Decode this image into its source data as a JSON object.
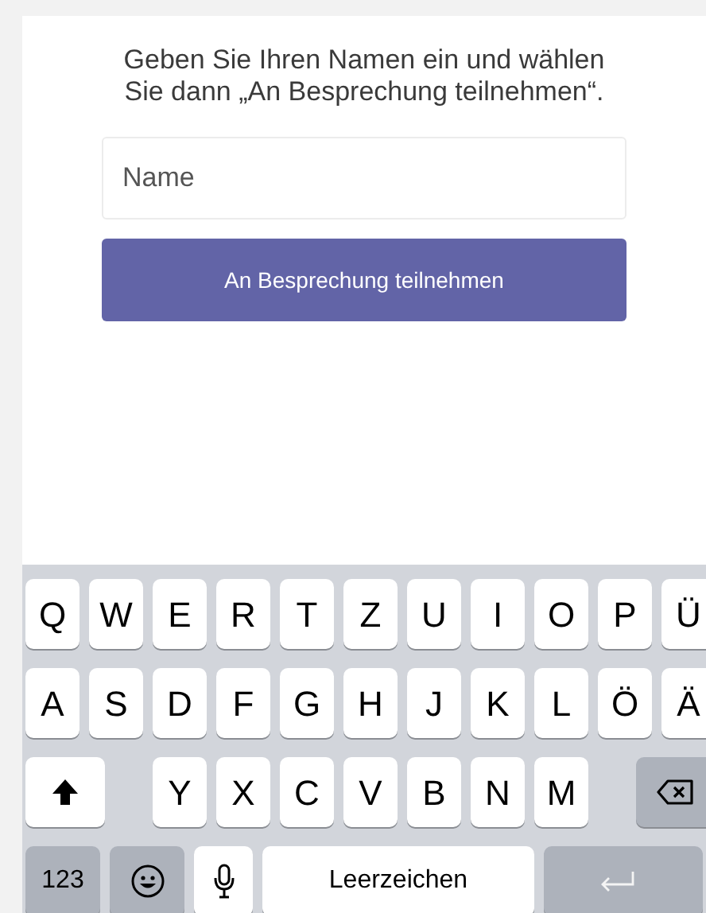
{
  "prompt": "Geben Sie Ihren Namen ein und wählen Sie dann „An Besprechung teilnehmen“.",
  "name_field": {
    "placeholder": "Name"
  },
  "join_button": {
    "label": "An Besprechung teilnehmen"
  },
  "keyboard": {
    "rows": [
      {
        "keys": [
          {
            "kind": "letter",
            "label": "Q"
          },
          {
            "kind": "letter",
            "label": "W"
          },
          {
            "kind": "letter",
            "label": "E"
          },
          {
            "kind": "letter",
            "label": "R"
          },
          {
            "kind": "letter",
            "label": "T"
          },
          {
            "kind": "letter",
            "label": "Z"
          },
          {
            "kind": "letter",
            "label": "U"
          },
          {
            "kind": "letter",
            "label": "I"
          },
          {
            "kind": "letter",
            "label": "O"
          },
          {
            "kind": "letter",
            "label": "P"
          },
          {
            "kind": "letter",
            "label": "Ü"
          }
        ]
      },
      {
        "keys": [
          {
            "kind": "letter",
            "label": "A"
          },
          {
            "kind": "letter",
            "label": "S"
          },
          {
            "kind": "letter",
            "label": "D"
          },
          {
            "kind": "letter",
            "label": "F"
          },
          {
            "kind": "letter",
            "label": "G"
          },
          {
            "kind": "letter",
            "label": "H"
          },
          {
            "kind": "letter",
            "label": "J"
          },
          {
            "kind": "letter",
            "label": "K"
          },
          {
            "kind": "letter",
            "label": "L"
          },
          {
            "kind": "letter",
            "label": "Ö"
          },
          {
            "kind": "letter",
            "label": "Ä"
          }
        ]
      },
      {
        "keys": [
          {
            "kind": "shift"
          },
          {
            "kind": "letter",
            "label": "Y"
          },
          {
            "kind": "letter",
            "label": "X"
          },
          {
            "kind": "letter",
            "label": "C"
          },
          {
            "kind": "letter",
            "label": "V"
          },
          {
            "kind": "letter",
            "label": "B"
          },
          {
            "kind": "letter",
            "label": "N"
          },
          {
            "kind": "letter",
            "label": "M"
          },
          {
            "kind": "backspace"
          }
        ]
      },
      {
        "keys": [
          {
            "kind": "numbers",
            "label": "123"
          },
          {
            "kind": "emoji"
          },
          {
            "kind": "mic"
          },
          {
            "kind": "space",
            "label": "Leerzeichen"
          },
          {
            "kind": "return"
          }
        ]
      }
    ]
  }
}
